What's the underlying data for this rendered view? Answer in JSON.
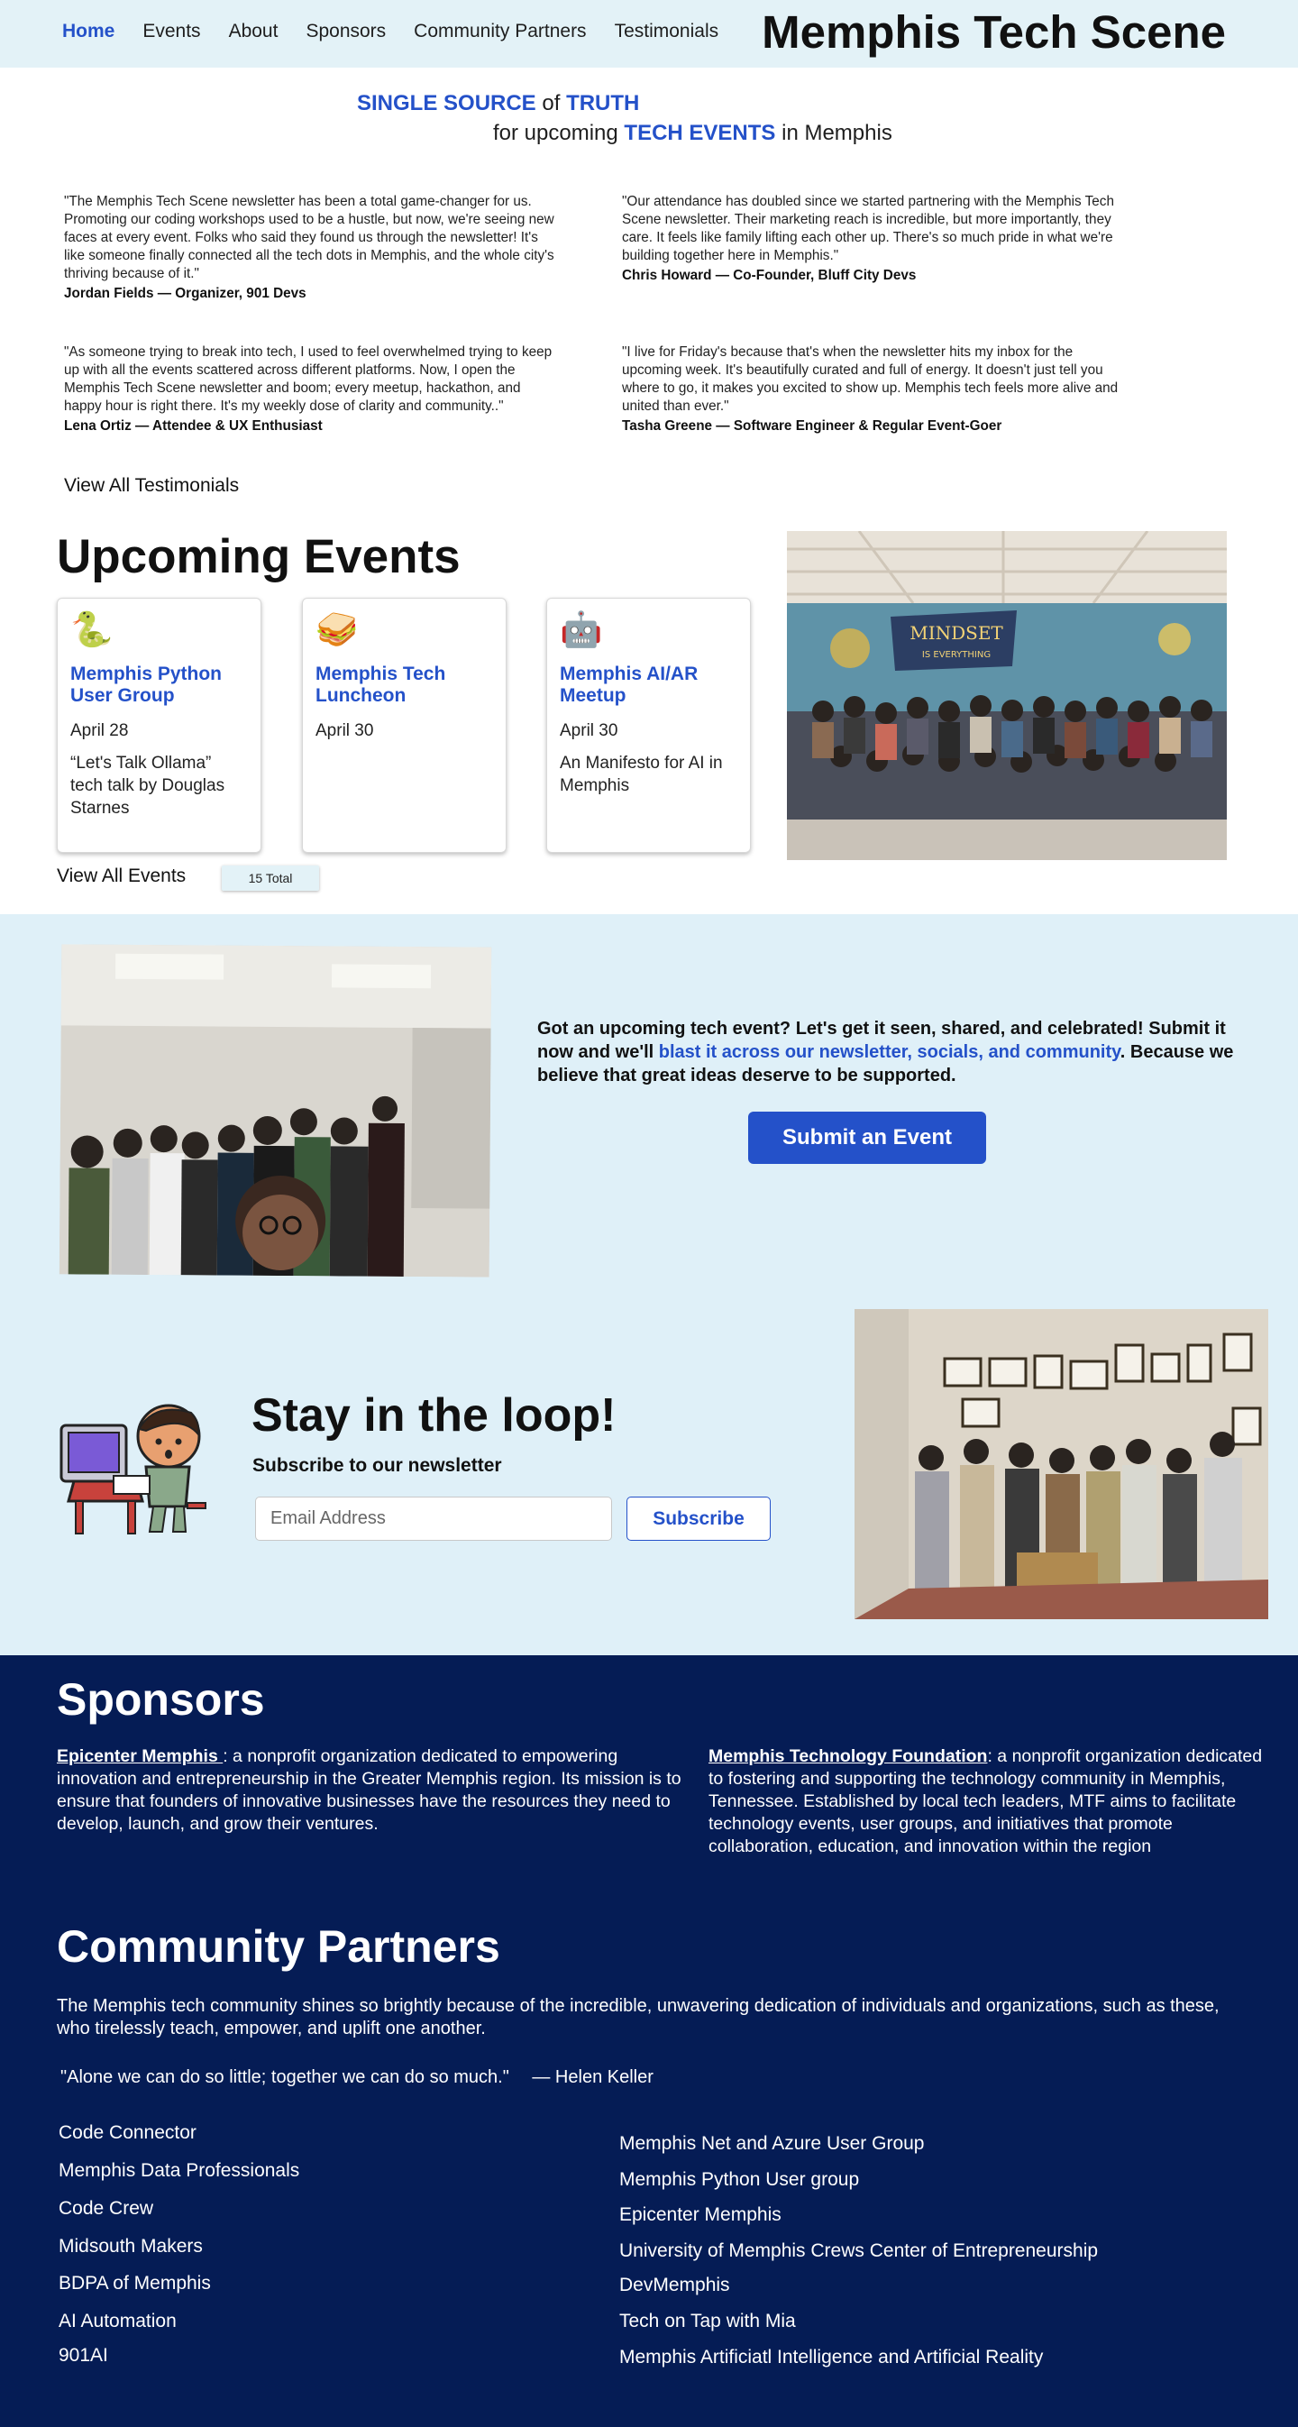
{
  "nav": {
    "items": [
      "Home",
      "Events",
      "About",
      "Sponsors",
      "Community Partners",
      "Testimonials"
    ],
    "site_title": "Memphis Tech Scene"
  },
  "hero": {
    "line1_a": "SINGLE SOURCE",
    "line1_b": " of ",
    "line1_c": "TRUTH",
    "line2_a": "for upcoming ",
    "line2_b": "TECH EVENTS",
    "line2_c": " in Memphis"
  },
  "testimonials": [
    {
      "quote": "\"The Memphis Tech Scene newsletter has been a total game-changer for us. Promoting our coding workshops used to be a hustle, but now, we're seeing new faces at every event. Folks who said they found us through the newsletter! It's like someone finally connected all the tech dots in Memphis, and the whole city's thriving because of it.\"",
      "author": "Jordan Fields — Organizer, 901 Devs"
    },
    {
      "quote": "\"Our attendance has doubled since we started partnering with the Memphis Tech Scene newsletter. Their marketing reach is incredible, but more importantly, they care. It feels like family lifting each other up. There's so much pride in what we're building together here in Memphis.\"",
      "author": "Chris Howard — Co-Founder, Bluff City Devs"
    },
    {
      "quote": "\"As someone trying to break into tech, I used to feel overwhelmed trying to keep up with all the events scattered across different platforms. Now, I open the Memphis Tech Scene newsletter and boom; every meetup, hackathon, and happy hour is right there. It's my weekly dose of clarity and community..\"",
      "author": "Lena Ortiz — Attendee & UX Enthusiast"
    },
    {
      "quote": "\"I live for Friday's because that's when the newsletter hits my inbox for the upcoming week. It's beautifully curated and full of energy. It doesn't just tell you where to go, it makes you excited to show up. Memphis tech feels more alive and united than ever.\"",
      "author": "Tasha Greene — Software Engineer & Regular Event-Goer"
    }
  ],
  "view_all_testimonials": "View All Testimonials",
  "events": {
    "heading": "Upcoming Events",
    "cards": [
      {
        "icon": "🐍",
        "icon_name": "snake-icon",
        "title": "Memphis Python User Group",
        "date": "April 28",
        "desc": "“Let's Talk Ollama” tech talk by Douglas Starnes"
      },
      {
        "icon": "🥪",
        "icon_name": "sandwich-icon",
        "title": "Memphis Tech Luncheon",
        "date": "April 30",
        "desc": ""
      },
      {
        "icon": "🤖",
        "icon_name": "robot-icon",
        "title": "Memphis AI/AR Meetup",
        "date": "April 30",
        "desc": "An Manifesto for AI in Memphis"
      }
    ],
    "view_all": "View All Events",
    "total": "15 Total",
    "mural_text_1": "MINDSET",
    "mural_text_2": "IS EVERYTHING"
  },
  "submit": {
    "text_a": "Got an upcoming tech event? Let's get it seen, shared, and celebrated! Submit it now and we'll ",
    "text_link": "blast it across our newsletter, socials, and community",
    "text_b": ". Because we believe that great ideas deserve to be supported.",
    "button": "Submit an Event"
  },
  "subscribe": {
    "title": "Stay in the loop!",
    "subtitle": "Subscribe to our newsletter",
    "placeholder": "Email Address",
    "button": "Subscribe"
  },
  "sponsors": {
    "heading": "Sponsors",
    "items": [
      {
        "name": "Epicenter Memphis ",
        "desc": ": a nonprofit organization dedicated to empowering innovation and entrepreneurship in the Greater Memphis region. Its mission is to ensure that founders of innovative businesses have the resources they need to develop, launch, and grow their ventures."
      },
      {
        "name": "Memphis Technology Foundation",
        "desc": ": a nonprofit organization dedicated to fostering and supporting the technology community in Memphis, Tennessee. Established by local tech leaders, MTF aims to facilitate technology events, user groups, and initiatives that promote collaboration, education, and innovation within the region"
      }
    ]
  },
  "community": {
    "heading": "Community Partners",
    "intro": "The Memphis tech community shines so brightly because of the incredible, unwavering dedication of individuals and organizations, such as these, who tirelessly teach, empower, and uplift one another.",
    "quote": "\"Alone we can do so little; together we can do so much.\"",
    "quote_author": "— Helen Keller",
    "left": [
      "Code Connector",
      "Memphis Data Professionals",
      "Code Crew",
      "Midsouth Makers",
      "BDPA of Memphis",
      "AI Automation",
      "901AI"
    ],
    "right": [
      "Memphis Net and Azure User Group",
      "Memphis Python User group",
      "Epicenter Memphis",
      "University of Memphis Crews Center of Entrepreneurship",
      "DevMemphis",
      "Tech on Tap with Mia",
      "Memphis Artificiatl Intelligence and Artificial Reality"
    ]
  },
  "colors": {
    "accent": "#2451c9",
    "nav_bg": "#e3f2f7",
    "light_bg": "#dff0f8",
    "dark_bg": "#051c55"
  }
}
